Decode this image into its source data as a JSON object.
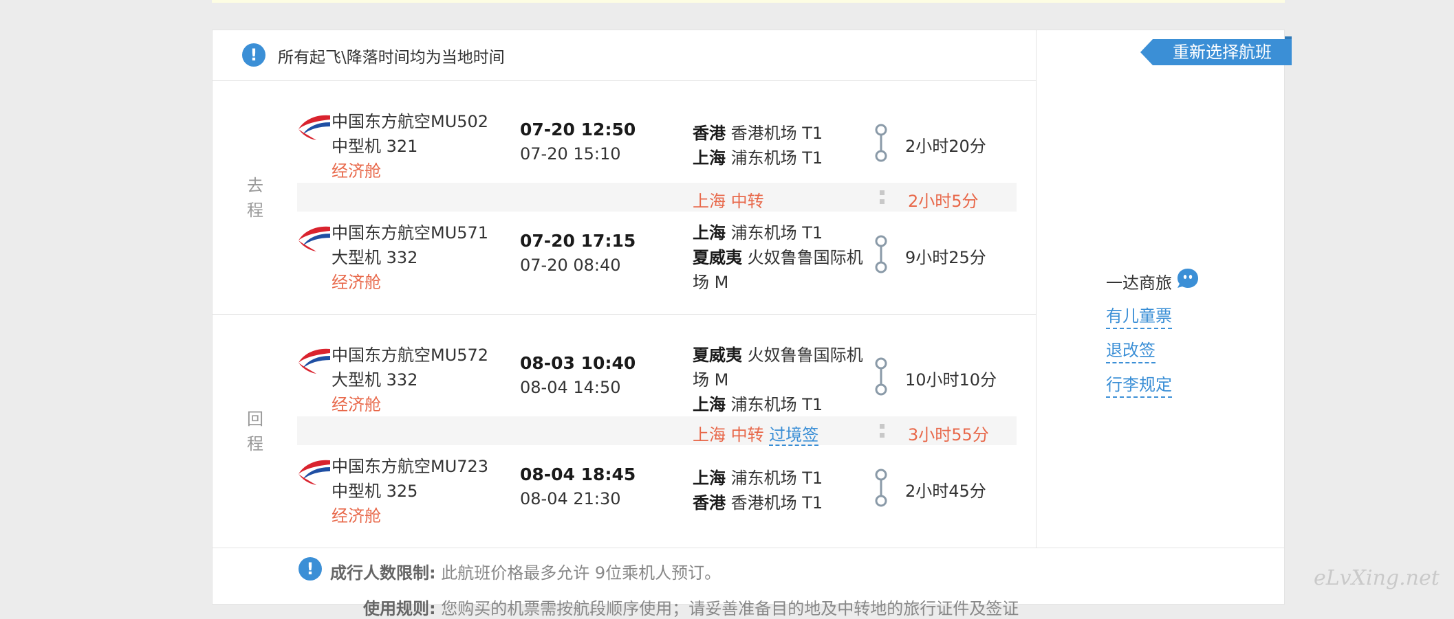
{
  "notice": {
    "text": "所有起飞\\降落时间均为当地时间"
  },
  "reselect_label": "重新选择航班",
  "outbound": {
    "label_1": "去",
    "label_2": "程",
    "leg1": {
      "flight": "中国东方航空MU502",
      "aircraft": "中型机 321",
      "cabin": "经济舱",
      "depart_time": "07-20 12:50",
      "arrive_time": "07-20 15:10",
      "from_city": "香港",
      "from_airport": "香港机场 T1",
      "to_city": "上海",
      "to_airport": "浦东机场 T1",
      "duration": "2小时20分"
    },
    "transfer": {
      "city": "上海",
      "label": "中转",
      "duration": "2小时5分"
    },
    "leg2": {
      "flight": "中国东方航空MU571",
      "aircraft": "大型机 332",
      "cabin": "经济舱",
      "depart_time": "07-20 17:15",
      "arrive_time": "07-20 08:40",
      "from_city": "上海",
      "from_airport": "浦东机场 T1",
      "to_city": "夏威夷",
      "to_airport_line1": "火奴鲁鲁国际机",
      "to_airport_line2": "场 M",
      "duration": "9小时25分"
    }
  },
  "return": {
    "label_1": "回",
    "label_2": "程",
    "leg1": {
      "flight": "中国东方航空MU572",
      "aircraft": "大型机 332",
      "cabin": "经济舱",
      "depart_time": "08-03 10:40",
      "arrive_time": "08-04 14:50",
      "from_city": "夏威夷",
      "from_airport_line1": "火奴鲁鲁国际机",
      "from_airport_line2": "场 M",
      "to_city": "上海",
      "to_airport": "浦东机场 T1",
      "duration": "10小时10分"
    },
    "transfer": {
      "city": "上海",
      "label": "中转",
      "visa_link": "过境签",
      "duration": "3小时55分"
    },
    "leg2": {
      "flight": "中国东方航空MU723",
      "aircraft": "中型机 325",
      "cabin": "经济舱",
      "depart_time": "08-04 18:45",
      "arrive_time": "08-04 21:30",
      "from_city": "上海",
      "from_airport": "浦东机场 T1",
      "to_city": "香港",
      "to_airport": "香港机场 T1",
      "duration": "2小时45分"
    }
  },
  "sidebar": {
    "brand": "一达商旅",
    "links": [
      "有儿童票",
      "退改签",
      "行李规定"
    ]
  },
  "limit": {
    "label": "成行人数限制:",
    "text": "此航班价格最多允许 9位乘机人预订。"
  },
  "rule": {
    "label": "使用规则:",
    "text": "您购买的机票需按航段顺序使用；请妥善准备目的地及中转地的旅行证件及签证"
  },
  "watermark": "eLvXing.net",
  "colors": {
    "accent": "#3b8fd6",
    "highlight": "#e8684a",
    "airline_red": "#d9232e",
    "airline_blue": "#1f4fa3"
  }
}
